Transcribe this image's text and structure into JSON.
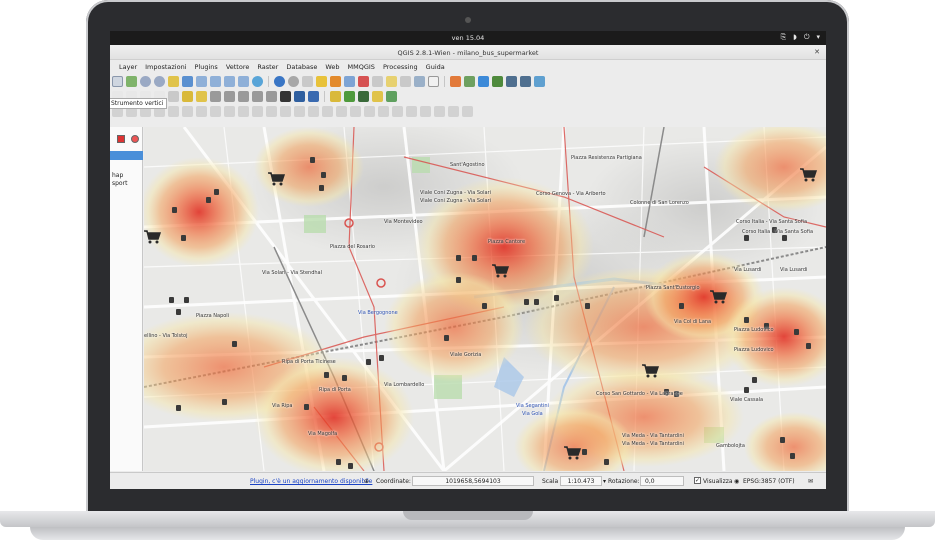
{
  "system_bar": {
    "clock": "ven 15.04"
  },
  "window": {
    "title": "QGIS 2.8.1-Wien - milano_bus_supermarket"
  },
  "menu": [
    "Layer",
    "Impostazioni",
    "Plugins",
    "Vettore",
    "Raster",
    "Database",
    "Web",
    "MMQGIS",
    "Processing",
    "Guida"
  ],
  "tooltip": "Strumento vertici",
  "left_panel": {
    "items": [
      "hap",
      "sport"
    ]
  },
  "map": {
    "labels": [
      "Sant'Agostino",
      "Piazza Resistenza Partigiana",
      "Viale Coni Zugna - Via Solari",
      "Viale Coni Zugna - Via Solari",
      "Corso Genova - Via Ariberto",
      "Colonne di San Lorenzo",
      "Via Montevideo",
      "Corso Italia - Via Santa Sofia",
      "Corso Italia - Via Santa Sofia",
      "Piazza del Rosario",
      "Piazza Cantore",
      "Via Solari - Via Stendhal",
      "Via Lusardi",
      "Via Lusardi",
      "Via Bergognone",
      "Piazza Sant'Eustorgio",
      "Piazza Napoli",
      "Via Col di Lana",
      "Piazza Ludovico",
      "ellino - Via Tolstoj",
      "Viale Gorizia",
      "Piazza Ludovico",
      "Corso San Gottardo - Via Lagrange",
      "Via Lombardello",
      "Ripa di Porta",
      "Viale Cassala",
      "Via Ripa",
      "Via Segantini",
      "Via Gola",
      "Via Meda - Via Tantardini",
      "Via Meda - Via Tantardini",
      "Gambolojta",
      "Ripa di Porta Ticinese",
      "Via Magolfa"
    ],
    "heat_colors": {
      "hot": "#e0261a",
      "warm": "#f4a15a",
      "cool": "#f7e7a8"
    }
  },
  "statusbar": {
    "plugin_notice": "Plugin, c'è un aggiornamento disponibile",
    "coord_label": "Coordinate:",
    "coord_value": "1019658,5694103",
    "scale_label": "Scala",
    "scale_value": "1:10.473",
    "rotation_label": "Rotazione:",
    "rotation_value": "0,0",
    "render_label": "Visualizza",
    "crs": "EPSG:3857 (OTF)"
  }
}
